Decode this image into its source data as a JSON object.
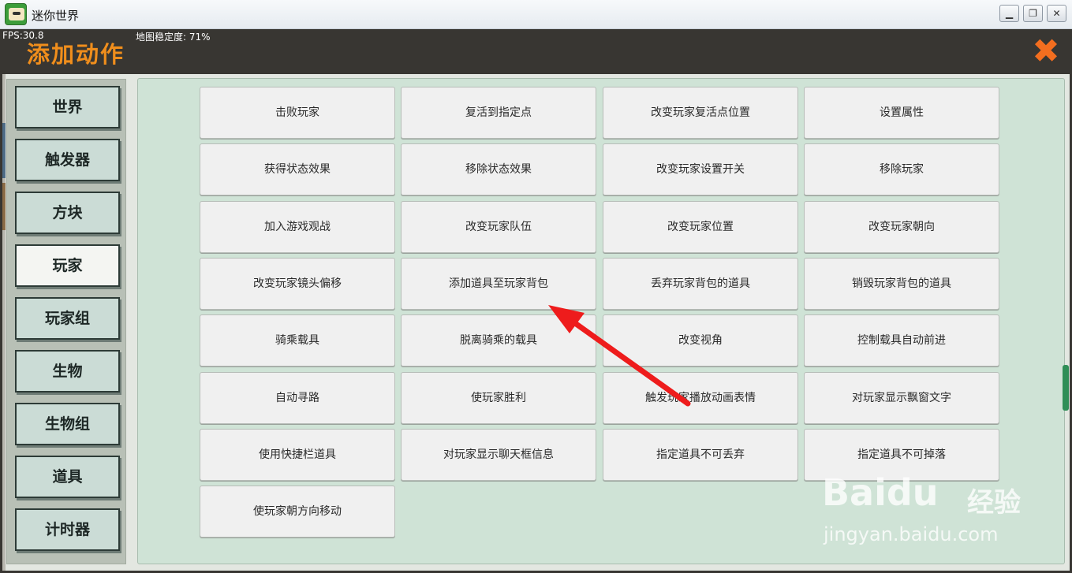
{
  "window": {
    "title": "迷你世界",
    "minimize": "▁",
    "restore": "❐",
    "close": "✕"
  },
  "hud": {
    "fps": "FPS:30.8",
    "stability": "地图稳定度: 71%"
  },
  "panel": {
    "title": "添加动作",
    "close": "✖"
  },
  "sidebar": {
    "items": [
      {
        "label": "世界"
      },
      {
        "label": "触发器"
      },
      {
        "label": "方块"
      },
      {
        "label": "玩家"
      },
      {
        "label": "玩家组"
      },
      {
        "label": "生物"
      },
      {
        "label": "生物组"
      },
      {
        "label": "道具"
      },
      {
        "label": "计时器"
      }
    ],
    "active_index": 3
  },
  "actions": [
    {
      "label": "击败玩家"
    },
    {
      "label": "复活到指定点"
    },
    {
      "label": "改变玩家复活点位置"
    },
    {
      "label": "设置属性"
    },
    {
      "label": "获得状态效果"
    },
    {
      "label": "移除状态效果"
    },
    {
      "label": "改变玩家设置开关"
    },
    {
      "label": "移除玩家"
    },
    {
      "label": "加入游戏观战"
    },
    {
      "label": "改变玩家队伍"
    },
    {
      "label": "改变玩家位置"
    },
    {
      "label": "改变玩家朝向"
    },
    {
      "label": "改变玩家镜头偏移"
    },
    {
      "label": "添加道具至玩家背包"
    },
    {
      "label": "丢弃玩家背包的道具"
    },
    {
      "label": "销毁玩家背包的道具"
    },
    {
      "label": "骑乘载具"
    },
    {
      "label": "脱离骑乘的载具"
    },
    {
      "label": "改变视角"
    },
    {
      "label": "控制载具自动前进"
    },
    {
      "label": "自动寻路"
    },
    {
      "label": "使玩家胜利"
    },
    {
      "label": "触发玩家播放动画表情"
    },
    {
      "label": "对玩家显示飘窗文字"
    },
    {
      "label": "使用快捷栏道具"
    },
    {
      "label": "对玩家显示聊天框信息"
    },
    {
      "label": "指定道具不可丢弃"
    },
    {
      "label": "指定道具不可掉落"
    },
    {
      "label": "使玩家朝方向移动"
    }
  ],
  "watermark": {
    "logo": "Baidu",
    "text": "经验",
    "url": "jingyan.baidu.com"
  },
  "colors": {
    "accent_orange": "#f08e1c",
    "close_orange": "#f36e1f",
    "annotation_red": "#ee1c1c",
    "panel_bg": "#cfe3d6"
  }
}
